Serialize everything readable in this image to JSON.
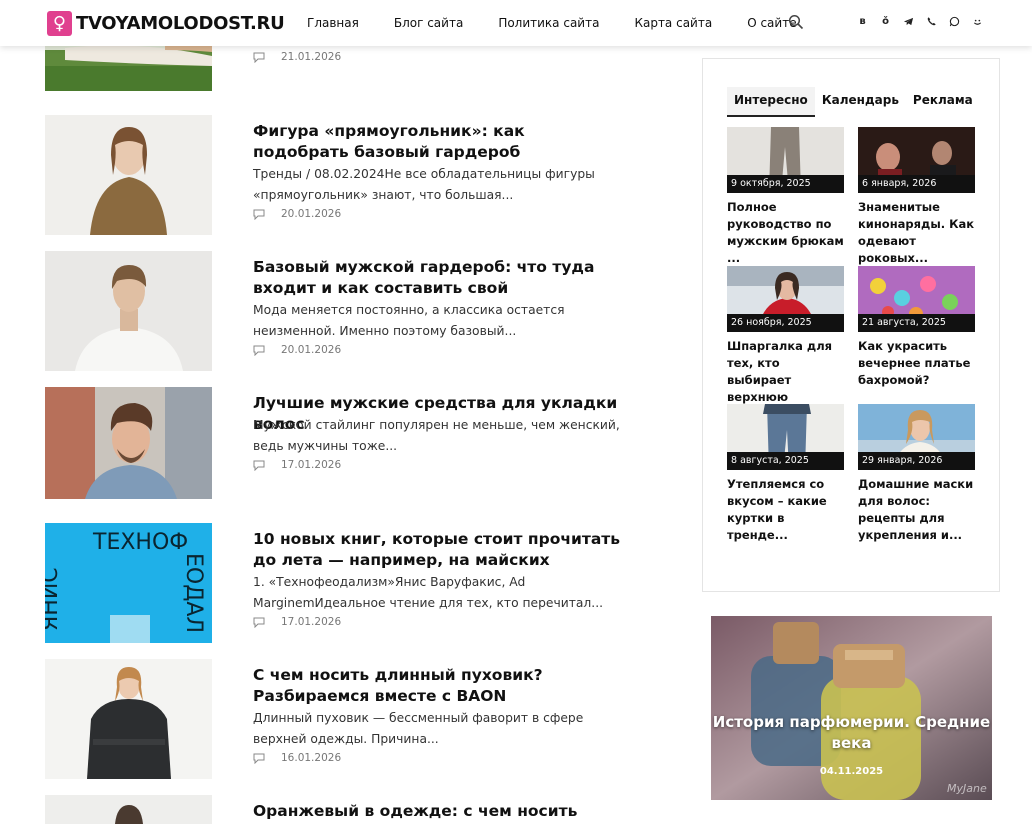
{
  "header": {
    "logo_text": "TVOYAMOLODOST.RU",
    "nav": [
      "Главная",
      "Блог сайта",
      "Политика сайта",
      "Карта сайта",
      "О сайте"
    ],
    "socials": [
      "vk-icon",
      "ok-icon",
      "telegram-icon",
      "viber-icon",
      "whatsapp-icon",
      "vk-smile-icon"
    ]
  },
  "feed": [
    {
      "title": "",
      "excerpt": "",
      "date": "21.01.2026"
    },
    {
      "title": "Фигура «прямоугольник»: как подобрать базовый гардероб",
      "excerpt": "Тренды / 08.02.2024Не все обладательницы фигуры «прямоугольник» знают, что большая...",
      "date": "20.01.2026"
    },
    {
      "title": "Базовый мужской гардероб: что туда входит и как составить свой",
      "excerpt": "Мода меняется постоянно, а классика остается неизменной. Именно поэтому базовый...",
      "date": "20.01.2026"
    },
    {
      "title": "Лучшие мужские средства для укладки волос",
      "excerpt": "Мужской стайлинг популярен не меньше, чем женский, ведь мужчины тоже...",
      "date": "17.01.2026"
    },
    {
      "title": "10 новых книг, которые стоит прочитать до лета — например, на майских",
      "excerpt": "1. «Технофеодализм»Янис Варуфакис, Ad MarginemИдеальное чтение для тех, кто перечитал...",
      "date": "17.01.2026"
    },
    {
      "title": "С чем носить длинный пуховик? Разбираемся вместе с BAON",
      "excerpt": "Длинный пуховик — бессменный фаворит в сфере верхней одежды. Причина...",
      "date": "16.01.2026"
    },
    {
      "title": "Оранжевый в одежде: с чем носить самый",
      "excerpt": "",
      "date": ""
    }
  ],
  "book_cover": {
    "line1": "ТЕХНОФ",
    "line2": "ЕОДАЛ",
    "side": "ЯНИС"
  },
  "widget": {
    "tabs": [
      "Интересно",
      "Календарь",
      "Реклама"
    ],
    "cards": [
      {
        "date": "9 октября, 2025",
        "title": "Полное руководство по мужским брюкам ..."
      },
      {
        "date": "6 января, 2026",
        "title": "Знаменитые кинонаряды. Как одевают роковых..."
      },
      {
        "date": "26 ноября, 2025",
        "title": "Шпаргалка для тех, кто выбирает верхнюю одежду..."
      },
      {
        "date": "21 августа, 2025",
        "title": "Как украсить вечернее платье бахромой?"
      },
      {
        "date": "8 августа, 2025",
        "title": "Утепляемся со вкусом – какие куртки в тренде..."
      },
      {
        "date": "29 января, 2026",
        "title": "Домашние маски для волос: рецепты для укрепления и..."
      }
    ]
  },
  "promo": {
    "title": "История парфюмерии. Средние века",
    "date": "04.11.2025",
    "watermark": "MyJane"
  }
}
